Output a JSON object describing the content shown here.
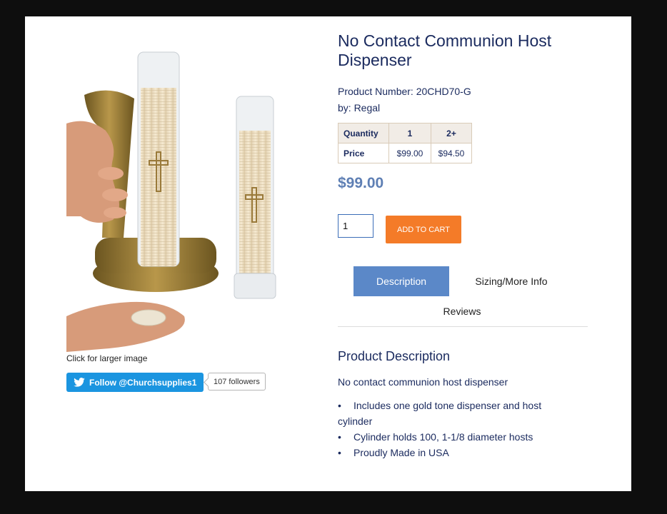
{
  "product": {
    "title": "No Contact Communion Host Dispenser",
    "product_number": "Product Number: 20CHD70-G",
    "brand": "by: Regal",
    "price": "$99.00"
  },
  "pricing_table": {
    "header": [
      "Quantity",
      "1",
      "2+"
    ],
    "row": [
      "Price",
      "$99.00",
      "$94.50"
    ]
  },
  "cart": {
    "quantity": "1",
    "add_label": "ADD TO CART"
  },
  "image": {
    "caption": "Click for larger image"
  },
  "social": {
    "follow_label": "Follow @Churchsupplies1",
    "followers": "107 followers"
  },
  "tabs": [
    {
      "label": "Description",
      "active": true
    },
    {
      "label": "Sizing/More Info",
      "active": false
    },
    {
      "label": "Reviews",
      "active": false
    }
  ],
  "description": {
    "heading": "Product Description",
    "text": "No contact communion host dispenser",
    "features": [
      "Includes one gold tone dispenser and host cylinder",
      "Cylinder holds 100, 1-1/8 diameter hosts",
      "Proudly Made in USA"
    ]
  },
  "colors": {
    "title": "#1a2a5e",
    "price": "#5e7fb4",
    "cart_button": "#f47b28",
    "active_tab": "#5b88c8",
    "twitter": "#1b95e0"
  },
  "icons": [
    "twitter-bird-icon",
    "cross-icon"
  ]
}
